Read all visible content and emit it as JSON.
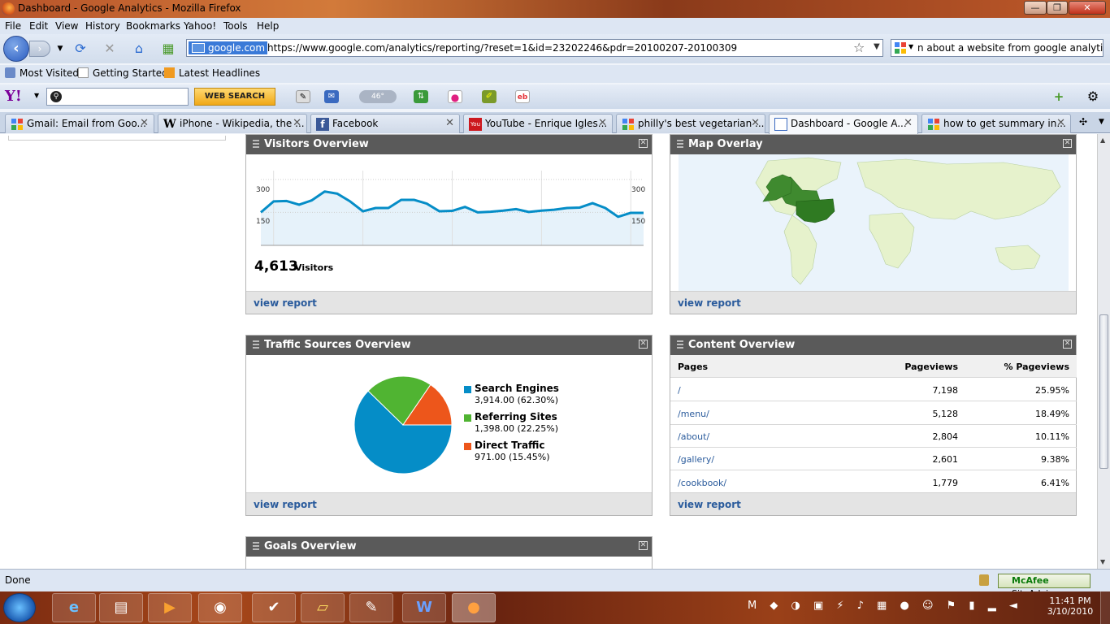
{
  "window": {
    "title": "Dashboard - Google Analytics - Mozilla Firefox"
  },
  "menu": [
    "File",
    "Edit",
    "View",
    "History",
    "Bookmarks",
    "Yahoo!",
    "Tools",
    "Help"
  ],
  "navbar": {
    "site_identity": "google.com",
    "url": "https://www.google.com/analytics/reporting/?reset=1&id=23202246&pdr=20100207-20100309",
    "search_value": "n about a website from google analytics"
  },
  "bookmarks": [
    "Most Visited",
    "Getting Started",
    "Latest Headlines"
  ],
  "yahoo": {
    "logo": "Y!",
    "search_button": "WEB SEARCH",
    "weather": "46°"
  },
  "tabs": [
    {
      "label": "Gmail: Email from Goo...",
      "icon": "gmail-icon"
    },
    {
      "label": "iPhone - Wikipedia, the ...",
      "icon": "wikipedia-icon"
    },
    {
      "label": "Facebook",
      "icon": "facebook-icon"
    },
    {
      "label": "YouTube - Enrique Igles...",
      "icon": "youtube-icon"
    },
    {
      "label": "philly's best vegetarian ...",
      "icon": "google-icon"
    },
    {
      "label": "Dashboard - Google A...",
      "icon": "analytics-icon",
      "active": true
    },
    {
      "label": "how to get summary in...",
      "icon": "google-icon"
    }
  ],
  "widgets": {
    "visitors": {
      "title": "Visitors Overview",
      "axis_top": "300",
      "axis_mid": "150",
      "count": "4,613",
      "count_label": "Visitors",
      "footer": "view report"
    },
    "map": {
      "title": "Map Overlay",
      "footer": "view report"
    },
    "traffic": {
      "title": "Traffic Sources Overview",
      "footer": "view report",
      "legend": [
        {
          "name": "Search Engines",
          "value": "3,914.00 (62.30%)",
          "color": "#058dc7"
        },
        {
          "name": "Referring Sites",
          "value": "1,398.00 (22.25%)",
          "color": "#50b432"
        },
        {
          "name": "Direct Traffic",
          "value": "971.00 (15.45%)",
          "color": "#ed561b"
        }
      ]
    },
    "content": {
      "title": "Content Overview",
      "footer": "view report",
      "headers": [
        "Pages",
        "Pageviews",
        "% Pageviews"
      ],
      "rows": [
        [
          "/",
          "7,198",
          "25.95%"
        ],
        [
          "/menu/",
          "5,128",
          "18.49%"
        ],
        [
          "/about/",
          "2,804",
          "10.11%"
        ],
        [
          "/gallery/",
          "2,601",
          "9.38%"
        ],
        [
          "/cookbook/",
          "1,779",
          "6.41%"
        ]
      ]
    },
    "goals": {
      "title": "Goals Overview"
    }
  },
  "chart_data": [
    {
      "type": "area",
      "ylim": [
        0,
        340
      ],
      "yticks": [
        "300",
        "150"
      ],
      "values": [
        150,
        200,
        202,
        185,
        205,
        245,
        235,
        200,
        155,
        170,
        170,
        207,
        207,
        190,
        155,
        157,
        175,
        150,
        153,
        158,
        165,
        152,
        158,
        162,
        170,
        172,
        192,
        170,
        130,
        148,
        148
      ],
      "color": "#058dc7"
    },
    {
      "type": "pie",
      "categories": [
        "Search Engines",
        "Referring Sites",
        "Direct Traffic"
      ],
      "values": [
        62.3,
        22.25,
        15.45
      ],
      "colors": [
        "#058dc7",
        "#50b432",
        "#ed561b"
      ]
    }
  ],
  "status": {
    "text": "Done",
    "mcafee_brand": "McAfee",
    "mcafee_label": "SiteAdvisor"
  },
  "taskbar": {
    "time": "11:41 PM",
    "date": "3/10/2010"
  }
}
